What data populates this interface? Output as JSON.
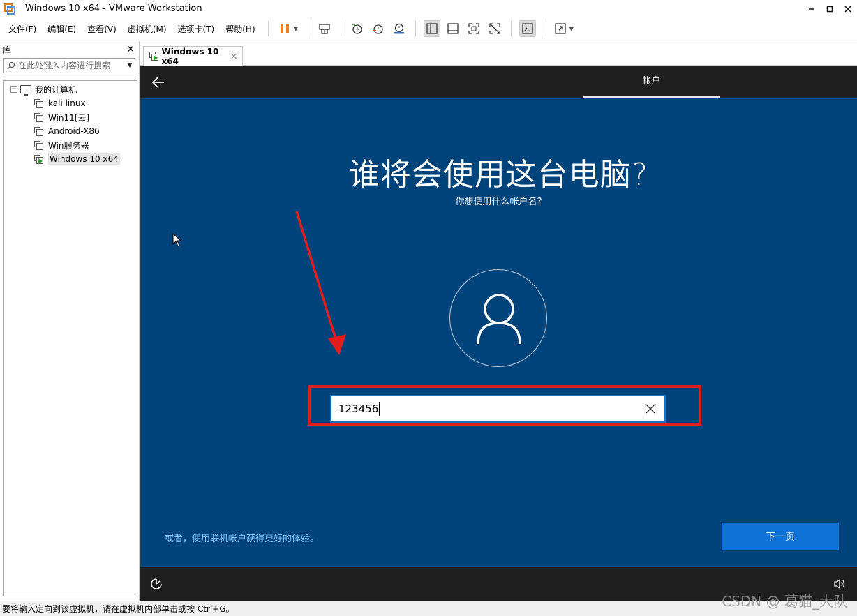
{
  "window": {
    "title": "Windows 10 x64 - VMware Workstation"
  },
  "menu": [
    "文件(F)",
    "编辑(E)",
    "查看(V)",
    "虚拟机(M)",
    "选项卡(T)",
    "帮助(H)"
  ],
  "library": {
    "title": "库",
    "search_placeholder": "在此处键入内容进行搜索",
    "root": "我的计算机",
    "vms": [
      "kali linux",
      "Win11[云]",
      "Android-X86",
      "Win服务器",
      "Windows 10 x64"
    ]
  },
  "tab": {
    "label": "Windows 10 x64"
  },
  "oobe": {
    "step_label": "帐户",
    "heading": "谁将会使用这台电脑?",
    "subheading": "你想使用什么帐户名?",
    "username_value": "123456",
    "online_link": "或者，使用联机帐户获得更好的体验。",
    "next_label": "下一页"
  },
  "status": {
    "text": "要将输入定向到该虚拟机，请在虚拟机内部单击或按 Ctrl+G。"
  },
  "watermark": "CSDN @ 葛猫_大队",
  "colors": {
    "oobe_bg": "#00447b",
    "next_button": "#0f72d6",
    "annotation_red": "#e01e1e"
  }
}
